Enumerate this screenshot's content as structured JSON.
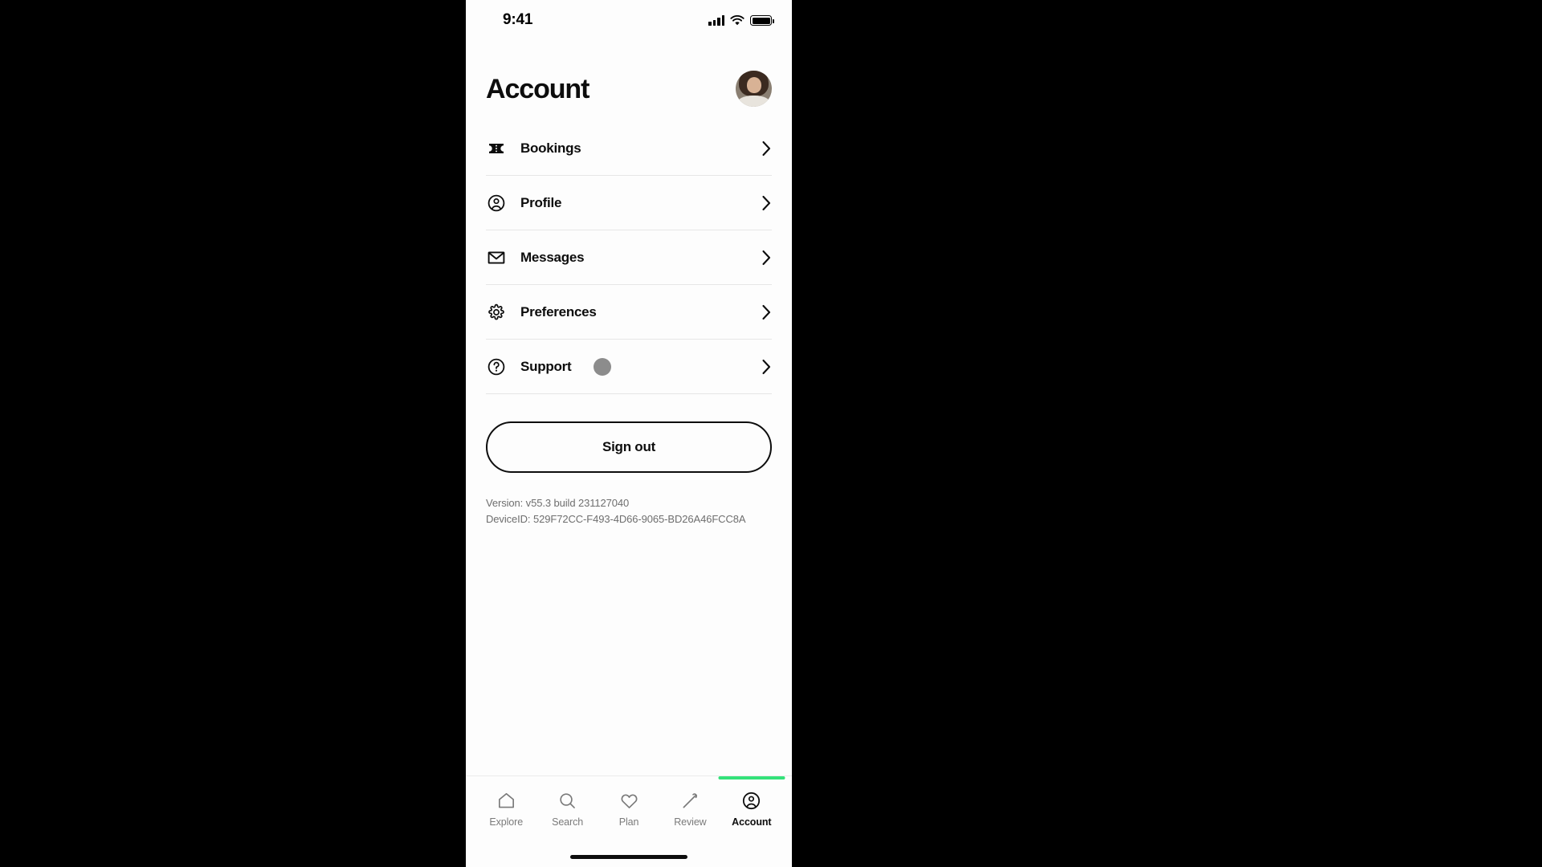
{
  "theme": {
    "background": "#fdfdfd",
    "text_primary": "#0d0d0d",
    "text_muted": "#6e6e6e",
    "tab_inactive": "#7a7a7a",
    "divider": "#e6e6e6",
    "accent_green": "#34e27a",
    "touch_dot": "#8c8c8c"
  },
  "status_bar": {
    "time": "9:41",
    "cellular_icon": "cellular-bars-icon",
    "wifi_icon": "wifi-icon",
    "battery_icon": "battery-full-icon",
    "battery_level": 100
  },
  "header": {
    "title": "Account",
    "avatar_name": "user-avatar"
  },
  "menu": {
    "items": [
      {
        "label": "Bookings",
        "icon": "ticket-icon",
        "chevron": "chevron-right-icon"
      },
      {
        "label": "Profile",
        "icon": "user-circle-icon",
        "chevron": "chevron-right-icon"
      },
      {
        "label": "Messages",
        "icon": "envelope-icon",
        "chevron": "chevron-right-icon"
      },
      {
        "label": "Preferences",
        "icon": "gear-icon",
        "chevron": "chevron-right-icon"
      },
      {
        "label": "Support",
        "icon": "question-circle-icon",
        "chevron": "chevron-right-icon"
      }
    ]
  },
  "sign_out": {
    "label": "Sign out"
  },
  "footer": {
    "version": "Version: v55.3 build 231127040",
    "device_id": "DeviceID: 529F72CC-F493-4D66-9065-BD26A46FCC8A"
  },
  "tab_bar": {
    "active_index": 4,
    "tabs": [
      {
        "label": "Explore",
        "icon": "home-icon"
      },
      {
        "label": "Search",
        "icon": "search-icon"
      },
      {
        "label": "Plan",
        "icon": "heart-icon"
      },
      {
        "label": "Review",
        "icon": "pencil-icon"
      },
      {
        "label": "Account",
        "icon": "user-circle-icon"
      }
    ]
  }
}
